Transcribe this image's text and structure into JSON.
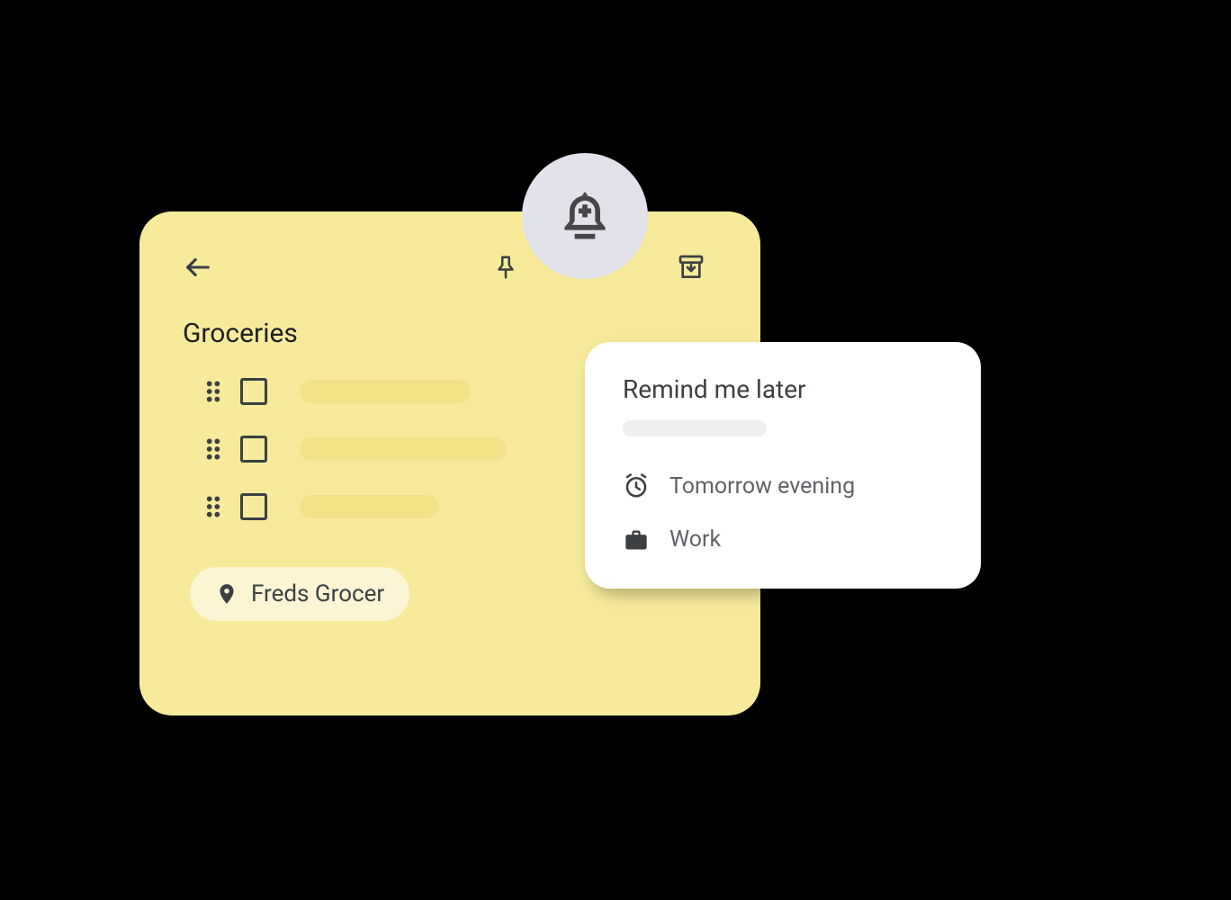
{
  "note": {
    "title": "Groceries",
    "location": "Freds Grocer",
    "colors": {
      "card_bg": "#F7EB9B",
      "placeholder_bg": "#F1E388",
      "chip_bg": "#FBF5D4"
    }
  },
  "bell_circle_bg": "#E2E2EA",
  "reminder": {
    "title": "Remind me later",
    "options": {
      "time": "Tomorrow evening",
      "place": "Work"
    }
  },
  "icons": {
    "back": "arrow-back",
    "pin": "push-pin",
    "reminder": "add-alert",
    "archive": "archive",
    "drag": "drag-indicator",
    "location": "place",
    "alarm": "alarm",
    "work": "work"
  }
}
